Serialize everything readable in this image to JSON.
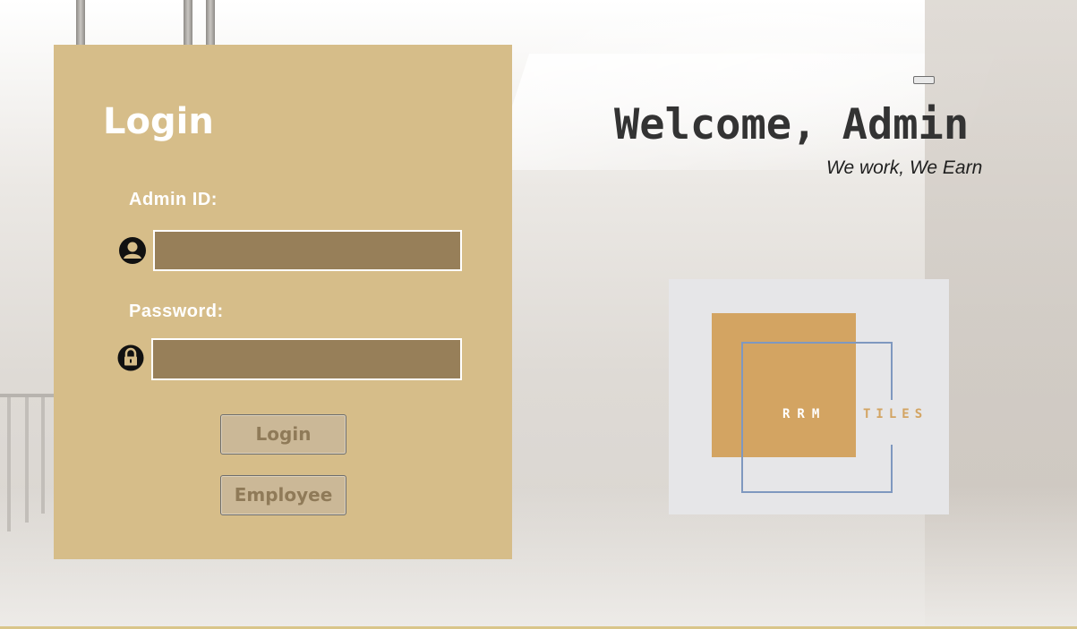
{
  "login_panel": {
    "title": "Login",
    "admin_id_label": "Admin ID:",
    "admin_id_value": "",
    "password_label": "Password:",
    "password_value": "",
    "login_button": "Login",
    "employee_button": "Employee",
    "icons": {
      "user": "user-icon",
      "lock": "lock-icon"
    }
  },
  "header": {
    "welcome": "Welcome, Admin",
    "tagline": "We work, We Earn"
  },
  "logo": {
    "brand": "RRM",
    "subtitle": "TILES"
  },
  "colors": {
    "panel": "#d6bd89",
    "input": "#977f59",
    "button": "#cbb897",
    "button_text": "#8f7a58",
    "logo_square": "#d3a462",
    "logo_outline": "#7f98bf"
  }
}
